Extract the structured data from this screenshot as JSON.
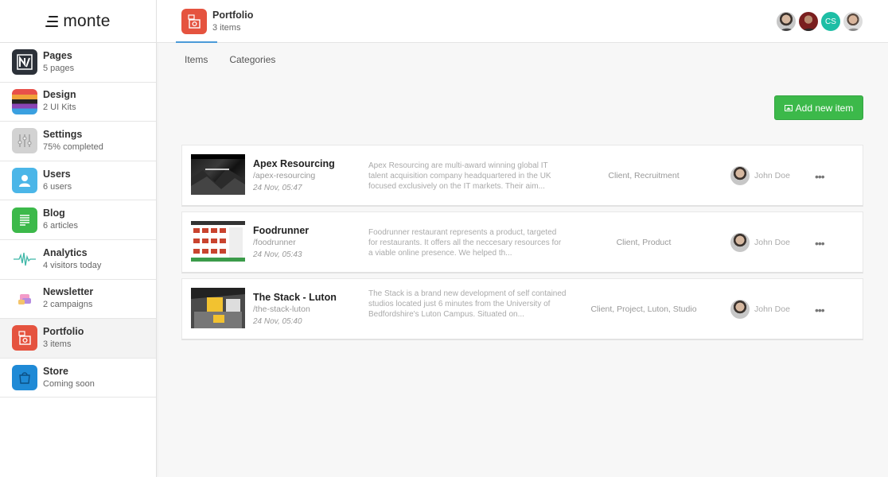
{
  "brand": {
    "name": "monte"
  },
  "sidebar": {
    "items": [
      {
        "title": "Pages",
        "sub": "5 pages",
        "icon": "pages-icon"
      },
      {
        "title": "Design",
        "sub": "2 UI Kits",
        "icon": "design-icon"
      },
      {
        "title": "Settings",
        "sub": "75% completed",
        "icon": "settings-icon"
      },
      {
        "title": "Users",
        "sub": "6 users",
        "icon": "users-icon"
      },
      {
        "title": "Blog",
        "sub": "6 articles",
        "icon": "blog-icon"
      },
      {
        "title": "Analytics",
        "sub": "4 visitors today",
        "icon": "analytics-icon"
      },
      {
        "title": "Newsletter",
        "sub": "2 campaigns",
        "icon": "newsletter-icon"
      },
      {
        "title": "Portfolio",
        "sub": "3 items",
        "icon": "portfolio-icon",
        "active": true
      },
      {
        "title": "Store",
        "sub": "Coming soon",
        "icon": "store-icon"
      }
    ]
  },
  "header": {
    "title": "Portfolio",
    "sub": "3 items",
    "avatars": [
      {
        "icon": "user-avatar-1"
      },
      {
        "icon": "user-avatar-2"
      },
      {
        "initials": "CS"
      },
      {
        "icon": "user-avatar-3"
      }
    ]
  },
  "tabs": [
    {
      "label": "Items"
    },
    {
      "label": "Categories"
    }
  ],
  "main": {
    "add_button_label": "Add new item",
    "items": [
      {
        "title": "Apex Resourcing",
        "slug": "/apex-resourcing",
        "date": "24 Nov, 05:47",
        "desc": "Apex Resourcing are multi-award winning global IT talent acquisition company headquartered in the UK focused exclusively on the IT markets. Their aim...",
        "tags": "Client, Recruitment",
        "author": "John Doe"
      },
      {
        "title": "Foodrunner",
        "slug": "/foodrunner",
        "date": "24 Nov, 05:43",
        "desc": "Foodrunner restaurant represents a product, targeted for restaurants. It offers all the neccesary resources for a viable online presence. We helped th...",
        "tags": "Client, Product",
        "author": "John Doe"
      },
      {
        "title": "The Stack - Luton",
        "slug": "/the-stack-luton",
        "date": "24 Nov, 05:40",
        "desc": "The Stack is a brand new development of self contained studios located just 6 minutes from the University of Bedfordshire's Luton Campus. Situated on...",
        "tags": "Client, Project, Luton, Studio",
        "author": "John Doe"
      }
    ]
  },
  "colors": {
    "accent_blue": "#4b9ad8",
    "button_green": "#3cb94a",
    "portfolio_red": "#e5533f"
  }
}
